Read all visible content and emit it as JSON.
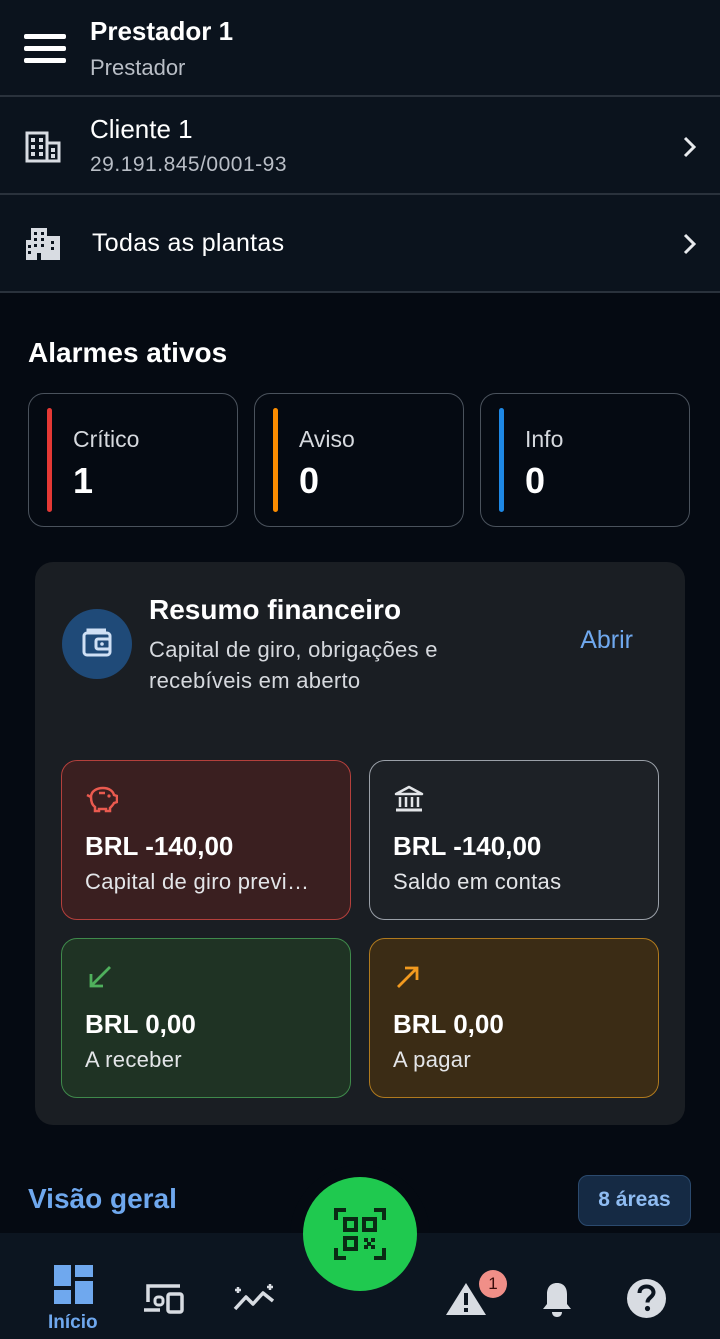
{
  "header": {
    "title": "Prestador 1",
    "subtitle": "Prestador"
  },
  "client": {
    "name": "Cliente 1",
    "document": "29.191.845/0001-93"
  },
  "plants": {
    "label": "Todas as plantas"
  },
  "alarms": {
    "title": "Alarmes ativos",
    "items": [
      {
        "label": "Crítico",
        "count": "1",
        "color": "#e53935"
      },
      {
        "label": "Aviso",
        "count": "0",
        "color": "#fb8c00"
      },
      {
        "label": "Info",
        "count": "0",
        "color": "#1e88e5"
      }
    ]
  },
  "finance": {
    "title": "Resumo financeiro",
    "description": "Capital de giro, obrigações e recebíveis em aberto",
    "open_label": "Abrir",
    "tiles": [
      {
        "amount": "BRL -140,00",
        "label": "Capital de giro previ…",
        "icon": "piggy-bank-icon"
      },
      {
        "amount": "BRL -140,00",
        "label": "Saldo em contas",
        "icon": "bank-icon"
      },
      {
        "amount": "BRL 0,00",
        "label": "A receber",
        "icon": "arrow-down-left-icon"
      },
      {
        "amount": "BRL 0,00",
        "label": "A pagar",
        "icon": "arrow-up-right-icon"
      }
    ]
  },
  "overview": {
    "title": "Visão geral",
    "areas_badge": "8 áreas"
  },
  "nav": {
    "home_label": "Início",
    "alerts_badge": "1"
  },
  "colors": {
    "accent": "#6fa8ee",
    "fab": "#1fc94f"
  }
}
